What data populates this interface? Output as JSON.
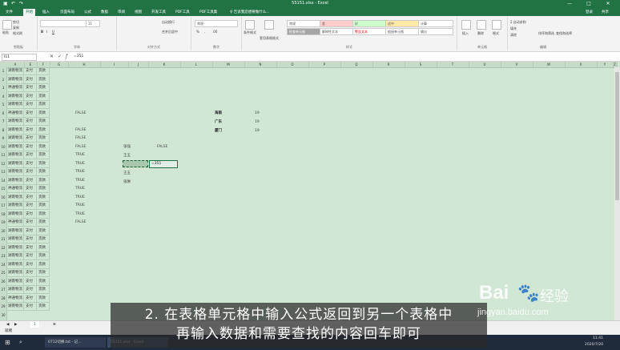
{
  "window": {
    "title": "55151.xlsx - Excel",
    "login": "登录",
    "share": "共享",
    "min_icon": "minimize-icon",
    "max_icon": "maximize-icon",
    "close_icon": "close-icon"
  },
  "tabs": [
    "文件",
    "开始",
    "插入",
    "页面布局",
    "公式",
    "数据",
    "审阅",
    "视图",
    "开发工具",
    "PDF工具",
    "PDF工具集",
    "♀ 告诉我您想要做什么..."
  ],
  "active_tab": "开始",
  "ribbon": {
    "groups": [
      "剪贴板",
      "字体",
      "对齐方式",
      "数字",
      "样式",
      "单元格",
      "编辑"
    ],
    "clipboard": {
      "cut": "剪切",
      "copy": "复制",
      "paste_format": "格式刷",
      "paste": "粘贴"
    },
    "font": {
      "name": "",
      "size": "11",
      "bold": "B",
      "italic": "I",
      "underline": "U"
    },
    "alignment": {
      "wrap": "自动换行",
      "merge": "合并后居中"
    },
    "number": {
      "format": "常规",
      "pct": "%",
      "comma": ",",
      "dec": ".00"
    },
    "styles": {
      "cond": "条件格式",
      "table": "套用表格格式",
      "cells": [
        "常规",
        "差",
        "好",
        "适中",
        "计算",
        "检查单元格",
        "解释性文本",
        "警告文本",
        "链接单元格",
        "输出"
      ]
    },
    "cells": {
      "insert": "插入",
      "delete": "删除",
      "format": "格式"
    },
    "editing": {
      "sum": "Σ 自动求和",
      "fill": "填充",
      "clear": "清除",
      "sort": "排序和筛选",
      "find": "查找和选择"
    }
  },
  "formula_bar": {
    "name_box": "I11",
    "formula": "=351"
  },
  "columns": [
    "A",
    "E",
    "F",
    "G",
    "H",
    "I",
    "J",
    "K",
    "L",
    "M",
    "N",
    "O",
    "P",
    "Q",
    "R",
    "S",
    "T",
    "U",
    "V",
    "W",
    "X",
    "Y",
    "Z",
    "AA"
  ],
  "rows": [
    "1",
    "2",
    "3",
    "4",
    "5",
    "6",
    "7",
    "8",
    "9",
    "10",
    "11",
    "12",
    "13",
    "14",
    "15",
    "16",
    "17",
    "18",
    "19",
    "20",
    "21",
    "22",
    "23",
    "24",
    "25",
    "26",
    "27",
    "28",
    "29",
    "30"
  ],
  "left_data": [
    [
      "湖南物流",
      "支付",
      "货款"
    ],
    [
      "湖南物流",
      "支付",
      "货款"
    ],
    [
      "神通物流",
      "支付",
      "货款"
    ],
    [
      "湖南物流",
      "支付",
      "货款"
    ],
    [
      "湖南物流",
      "支付",
      "货款"
    ],
    [
      "神通物流",
      "支付",
      "货款"
    ],
    [
      "湖南物流",
      "支付",
      "货款"
    ],
    [
      "湖南物流",
      "支付",
      "货款"
    ],
    [
      "湖南物流",
      "支付",
      "货款"
    ],
    [
      "湖南物流",
      "支付",
      "货款"
    ],
    [
      "湖南物流",
      "支付",
      "货款"
    ],
    [
      "湖南物流",
      "支付",
      "货款"
    ],
    [
      "湖南物流",
      "支付",
      "货款"
    ],
    [
      "湖南物流",
      "支付",
      "货款"
    ],
    [
      "神通物流",
      "支付",
      "货款"
    ],
    [
      "湖南物流",
      "支付",
      "货款"
    ],
    [
      "湖南物流",
      "支付",
      "货款"
    ],
    [
      "湖南物流",
      "支付",
      "货款"
    ],
    [
      "神通物流",
      "支付",
      "货款"
    ],
    [
      "湖南物流",
      "支付",
      "货款"
    ],
    [
      "湖南物流",
      "支付",
      "货款"
    ],
    [
      "湖南物流",
      "支付",
      "货款"
    ],
    [
      "湖南物流",
      "支付",
      "货款"
    ],
    [
      "湖南物流",
      "支付",
      "货款"
    ],
    [
      "湖南物流",
      "支付",
      "货款"
    ],
    [
      "湖南物流",
      "支付",
      "货款"
    ],
    [
      "湖南物流",
      "支付",
      "货款"
    ],
    [
      "神通物流",
      "支付",
      "货款"
    ],
    [
      "湖南物流",
      "支付",
      "货款"
    ]
  ],
  "h_col": [
    "",
    "",
    "",
    "",
    "",
    "FALSE",
    "",
    "FALSE",
    "FALSE",
    "FALSE",
    "TRUE",
    "TRUE",
    "TRUE",
    "TRUE",
    "TRUE",
    "TRUE",
    "TRUE",
    "TRUE",
    "FALSE"
  ],
  "names": [
    "张强",
    "王五",
    "李四",
    "王五",
    "张琳"
  ],
  "false_label": "FALSE",
  "edit_value": "=351",
  "provinces": [
    {
      "name": "海南",
      "value": "19"
    },
    {
      "name": "广东",
      "value": "19"
    },
    {
      "name": "厦门",
      "value": "19"
    }
  ],
  "sheet_tabs": {
    "tab1": "1",
    "add": "⊕"
  },
  "status": {
    "ready": "就绪"
  },
  "taskbar": {
    "items": [
      "0712切换.txt - 记...",
      "55151.xlsx - Excel"
    ],
    "time": "11:41",
    "date": "2020/7/20"
  },
  "caption": {
    "line1": "2. 在表格单元格中输入公式返回到另一个表格中",
    "line2": "再输入数据和需要查找的内容回车即可"
  },
  "watermark": {
    "brand": "Bai",
    "brand2": "经验",
    "url": "jingyan.baidu.com"
  }
}
